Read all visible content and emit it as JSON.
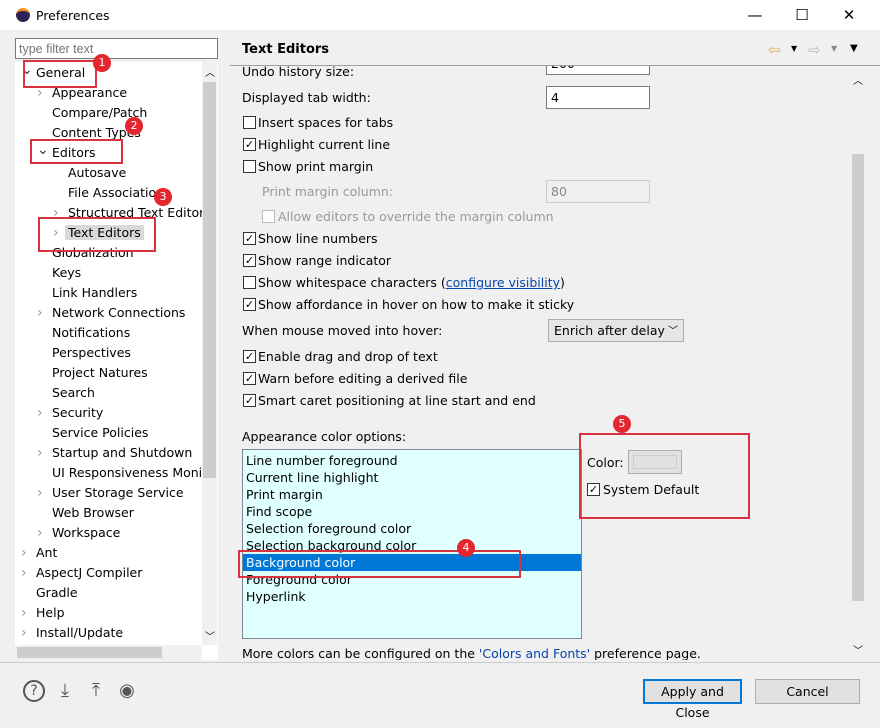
{
  "window": {
    "title": "Preferences",
    "minimize": "—",
    "maximize": "☐",
    "close": "✕"
  },
  "filter": {
    "placeholder": "type filter text"
  },
  "tree": [
    {
      "label": "General",
      "indent": 0,
      "chevron": "expanded"
    },
    {
      "label": "Appearance",
      "indent": 1,
      "chevron": "collapsed"
    },
    {
      "label": "Compare/Patch",
      "indent": 1,
      "chevron": "none"
    },
    {
      "label": "Content Types",
      "indent": 1,
      "chevron": "none"
    },
    {
      "label": "Editors",
      "indent": 1,
      "chevron": "expanded"
    },
    {
      "label": "Autosave",
      "indent": 2,
      "chevron": "none"
    },
    {
      "label": "File Associations",
      "indent": 2,
      "chevron": "none"
    },
    {
      "label": "Structured Text Editors",
      "indent": 2,
      "chevron": "collapsed"
    },
    {
      "label": "Text Editors",
      "indent": 2,
      "chevron": "collapsed",
      "selected": true
    },
    {
      "label": "Globalization",
      "indent": 1,
      "chevron": "none"
    },
    {
      "label": "Keys",
      "indent": 1,
      "chevron": "none"
    },
    {
      "label": "Link Handlers",
      "indent": 1,
      "chevron": "none"
    },
    {
      "label": "Network Connections",
      "indent": 1,
      "chevron": "collapsed"
    },
    {
      "label": "Notifications",
      "indent": 1,
      "chevron": "none"
    },
    {
      "label": "Perspectives",
      "indent": 1,
      "chevron": "none"
    },
    {
      "label": "Project Natures",
      "indent": 1,
      "chevron": "none"
    },
    {
      "label": "Search",
      "indent": 1,
      "chevron": "none"
    },
    {
      "label": "Security",
      "indent": 1,
      "chevron": "collapsed"
    },
    {
      "label": "Service Policies",
      "indent": 1,
      "chevron": "none"
    },
    {
      "label": "Startup and Shutdown",
      "indent": 1,
      "chevron": "collapsed"
    },
    {
      "label": "UI Responsiveness Monito",
      "indent": 1,
      "chevron": "none"
    },
    {
      "label": "User Storage Service",
      "indent": 1,
      "chevron": "collapsed"
    },
    {
      "label": "Web Browser",
      "indent": 1,
      "chevron": "none"
    },
    {
      "label": "Workspace",
      "indent": 1,
      "chevron": "collapsed"
    },
    {
      "label": "Ant",
      "indent": 0,
      "chevron": "collapsed"
    },
    {
      "label": "AspectJ Compiler",
      "indent": 0,
      "chevron": "collapsed"
    },
    {
      "label": "Gradle",
      "indent": 0,
      "chevron": "none"
    },
    {
      "label": "Help",
      "indent": 0,
      "chevron": "collapsed"
    },
    {
      "label": "Install/Update",
      "indent": 0,
      "chevron": "collapsed"
    }
  ],
  "page": {
    "title": "Text Editors",
    "undo_label": "Undo history size:",
    "undo_value": "200",
    "tab_width_label": "Displayed tab width:",
    "tab_width_value": "4",
    "checks": [
      {
        "label": "Insert spaces for tabs",
        "checked": false
      },
      {
        "label": "Highlight current line",
        "checked": true
      },
      {
        "label": "Show print margin",
        "checked": false
      }
    ],
    "print_margin_label": "Print margin column:",
    "print_margin_value": "80",
    "allow_override_label": "Allow editors to override the margin column",
    "checks2": [
      {
        "label": "Show line numbers",
        "checked": true
      },
      {
        "label": "Show range indicator",
        "checked": true
      },
      {
        "label": "Show whitespace characters (",
        "checked": false,
        "link": "configure visibility",
        "suffix": ")"
      },
      {
        "label": "Show affordance in hover on how to make it sticky",
        "checked": true
      }
    ],
    "hover_label": "When mouse moved into hover:",
    "hover_value": "Enrich after delay",
    "checks3": [
      {
        "label": "Enable drag and drop of text",
        "checked": true
      },
      {
        "label": "Warn before editing a derived file",
        "checked": true
      },
      {
        "label": "Smart caret positioning at line start and end",
        "checked": true
      }
    ],
    "appearance_label": "Appearance color options:",
    "color_options": [
      "Line number foreground",
      "Current line highlight",
      "Print margin",
      "Find scope",
      "Selection foreground color",
      "Selection background color",
      "Background color",
      "Foreground color",
      "Hyperlink"
    ],
    "selected_option": "Background color",
    "color_label": "Color:",
    "color_swatch": "#e1e1e1",
    "system_default_label": "System Default",
    "system_default_checked": true,
    "more_colors_prefix": "More colors can be configured on the ",
    "more_colors_link": "'Colors and Fonts'",
    "more_colors_suffix": " preference page."
  },
  "buttons": {
    "apply_close": "Apply and Close",
    "cancel": "Cancel"
  },
  "annotations": [
    "1",
    "2",
    "3",
    "4",
    "5"
  ],
  "colors": {
    "annotation": "#d9333f",
    "selection": "#0078d7",
    "list_bg": "#e0ffff"
  }
}
